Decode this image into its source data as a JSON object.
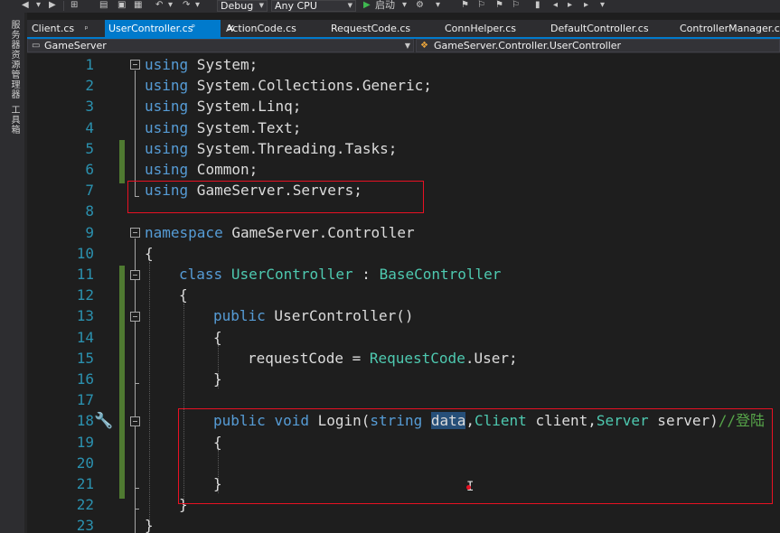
{
  "toolbar": {
    "configuration": "Debug",
    "platform": "Any CPU",
    "start_label": "启动"
  },
  "side_strip": {
    "server_explorer": "服务器资源管理器",
    "toolbox": "工具箱"
  },
  "tabs": [
    {
      "label": "Client.cs"
    },
    {
      "label": "UserController.cs"
    },
    {
      "label": "ActionCode.cs"
    },
    {
      "label": "RequestCode.cs"
    },
    {
      "label": "ConnHelper.cs"
    },
    {
      "label": "DefaultController.cs"
    },
    {
      "label": "ControllerManager.cs"
    }
  ],
  "tab_close_glyph": "✕",
  "tab_pin_glyph": "ᵖ",
  "navbar": {
    "project": "GameServer",
    "member": "GameServer.Controller.UserController"
  },
  "editor": {
    "line_numbers": [
      "1",
      "2",
      "3",
      "4",
      "5",
      "6",
      "7",
      "8",
      "9",
      "10",
      "11",
      "12",
      "13",
      "14",
      "15",
      "16",
      "17",
      "18",
      "19",
      "20",
      "21",
      "22",
      "23"
    ],
    "lines": [
      [
        "using",
        " System;"
      ],
      [
        "using",
        " System.Collections.Generic;"
      ],
      [
        "using",
        " System.Linq;"
      ],
      [
        "using",
        " System.Text;"
      ],
      [
        "using",
        " System.Threading.Tasks;"
      ],
      [
        "using",
        " Common;"
      ],
      [
        "using",
        " GameServer.Servers;"
      ],
      [
        "",
        ""
      ],
      [
        "namespace",
        " GameServer.Controller"
      ],
      [
        "{"
      ],
      [
        "class",
        "UserController",
        " : ",
        "BaseController"
      ],
      [
        "{"
      ],
      [
        "public",
        " UserController()"
      ],
      [
        "{"
      ],
      [
        "requestCode = ",
        "RequestCode",
        ".User;"
      ],
      [
        "}"
      ],
      [
        ""
      ],
      [
        "public",
        " ",
        "void",
        " Login(",
        "string",
        " ",
        "data",
        ",",
        "Client",
        " client,",
        "Server",
        " server)",
        "//登陆"
      ],
      [
        "{"
      ],
      [
        ""
      ],
      [
        "}"
      ],
      [
        "}"
      ],
      [
        "}"
      ]
    ],
    "ibeam_glyph": "I"
  },
  "colors": {
    "keyword": "#569cd6",
    "type": "#4ec9b0",
    "comment": "#57a64a",
    "line_number": "#2b91af",
    "highlight_box": "#e81123",
    "accent": "#007acc"
  }
}
